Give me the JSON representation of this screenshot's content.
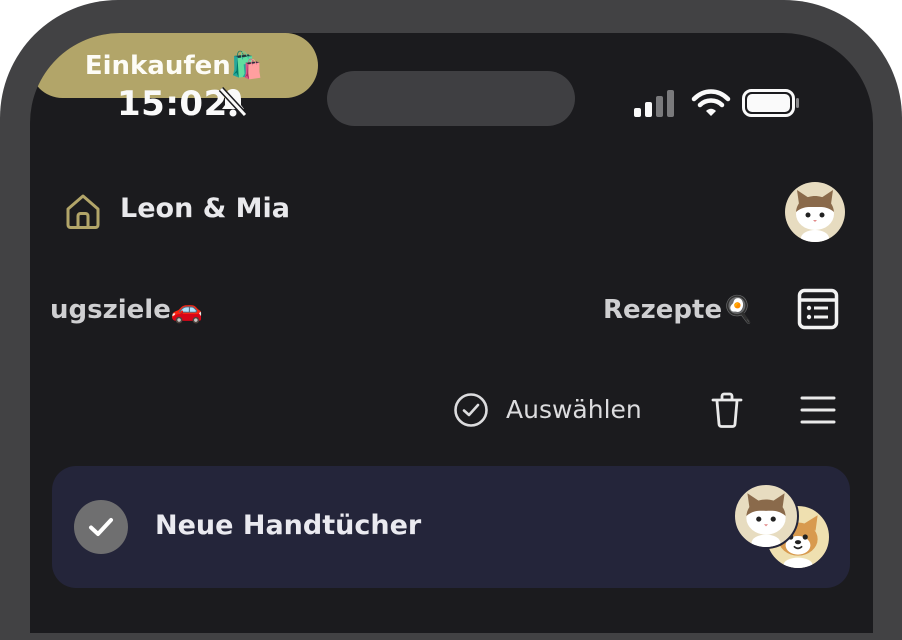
{
  "status_bar": {
    "time": "15:02"
  },
  "header": {
    "household_name": "Leon & Mia",
    "avatar": "cat-avatar"
  },
  "tabs": [
    {
      "label": "ugsziele🚗",
      "active": false
    },
    {
      "label": "Einkaufen🛍️",
      "active": true
    },
    {
      "label": "Rezepte🍳",
      "active": false
    }
  ],
  "toolbar": {
    "select_label": "Auswählen"
  },
  "list_items": [
    {
      "title": "Neue Handtücher",
      "done": true,
      "assignees": [
        "cat-avatar",
        "dog-avatar"
      ]
    }
  ],
  "colors": {
    "accent": "#b2a569",
    "background": "#1b1b1e",
    "card": "#24253a"
  }
}
